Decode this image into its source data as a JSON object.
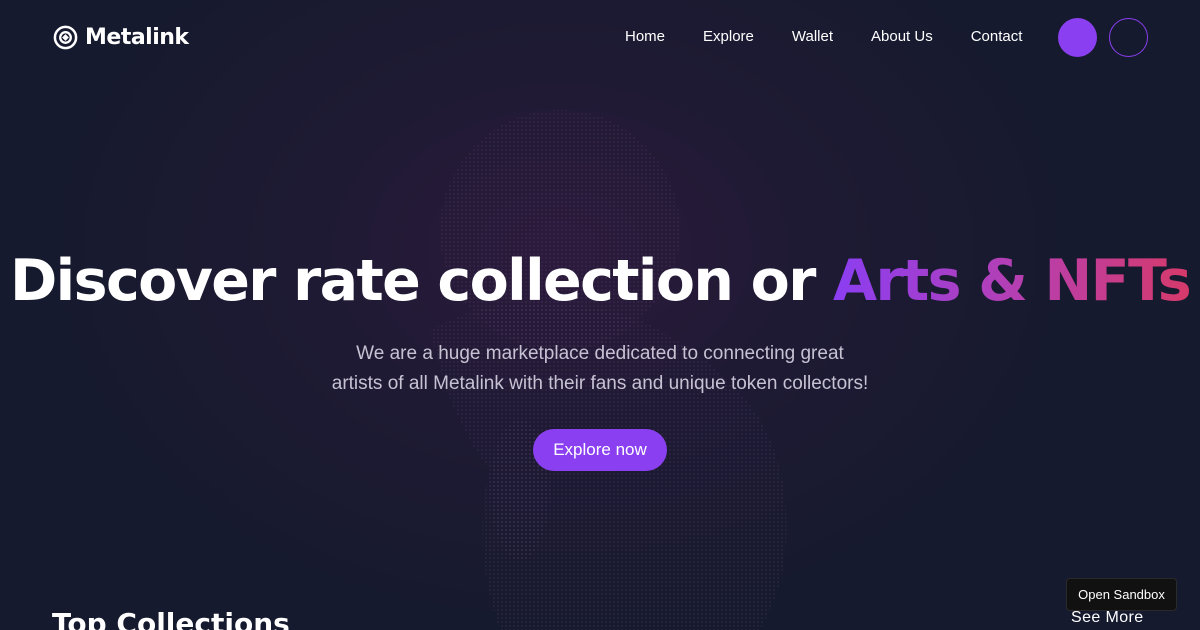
{
  "brand": {
    "name": "Metalink",
    "icon": "metalink-logo-icon"
  },
  "nav": {
    "items": [
      "Home",
      "Explore",
      "Wallet",
      "About Us",
      "Contact"
    ]
  },
  "header_actions": {
    "filled_color": "#8a3ff0",
    "outline_color": "#8a3ff0"
  },
  "hero": {
    "title_main": "Discover rate collection or ",
    "title_accent": "Arts & NFTs",
    "accent_gradient": [
      "#8b3ef2",
      "#b43fb4",
      "#d63a6a"
    ],
    "subtitle_line1": "We are a huge marketplace dedicated to connecting great",
    "subtitle_line2": "artists of all Metalink with their fans and unique token collectors!",
    "cta_label": "Explore now"
  },
  "collections": {
    "title": "Top Collections",
    "see_more_label": "See More"
  },
  "sandbox": {
    "label": "Open Sandbox"
  },
  "colors": {
    "background": "#161a2e",
    "accent": "#8a3ff0",
    "subtitle": "#c7c2d3"
  }
}
